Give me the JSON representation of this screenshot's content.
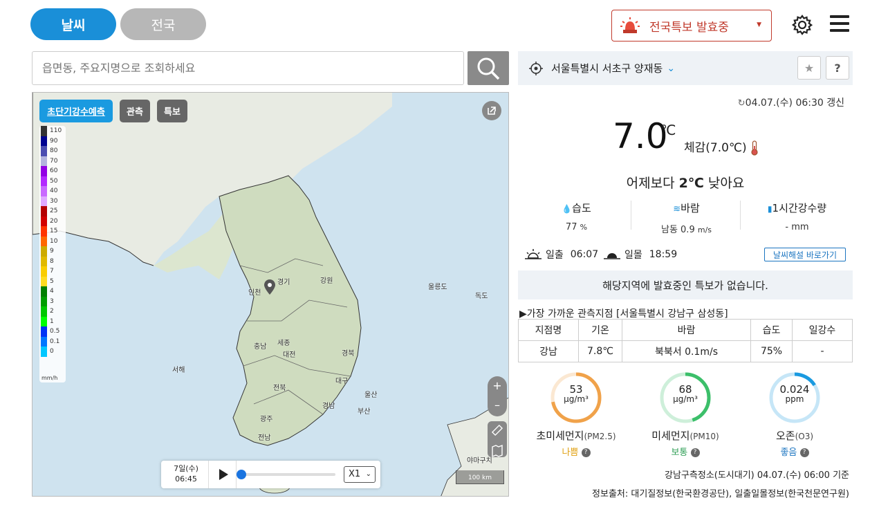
{
  "tabs": {
    "weather": "날씨",
    "national": "전국"
  },
  "alert": {
    "label": "전국특보 발효중",
    "color": "#c0392b"
  },
  "search": {
    "placeholder": "읍면동, 주요지명으로 조회하세요"
  },
  "map": {
    "buttons": {
      "precip": "초단기강수예측",
      "observe": "관측",
      "warning": "특보"
    },
    "legend": {
      "values": [
        "110",
        "90",
        "80",
        "70",
        "60",
        "50",
        "40",
        "30",
        "25",
        "20",
        "15",
        "10",
        "9",
        "8",
        "7",
        "5",
        "4",
        "3",
        "2",
        "1",
        "0.5",
        "0.1",
        "0"
      ],
      "colors": [
        "#333333",
        "#000390",
        "#4c4eb1",
        "#b3b4de",
        "#9300e4",
        "#b329ff",
        "#c969ff",
        "#e0a9ff",
        "#b40000",
        "#d20000",
        "#ff3300",
        "#ff6600",
        "#ccaa00",
        "#e0b900",
        "#f9cd00",
        "#ffdc1f",
        "#007f00",
        "#009d00",
        "#00c700",
        "#00ff00",
        "#0033f5",
        "#0077ff",
        "#00c7ff"
      ],
      "unit": "mm/h"
    },
    "labels": {
      "gyeonggi": "경기",
      "gangwon": "강원",
      "incheon": "인천",
      "ulleungdo": "울릉도",
      "dokdo": "독도",
      "chungnam": "충남",
      "sejong": "세종",
      "daejeon": "대전",
      "gyeongbuk": "경북",
      "seohae": "서해",
      "jeonbuk": "전북",
      "daegu": "대구",
      "ulsan": "울산",
      "gyeongnam": "경남",
      "busan": "부산",
      "gwangju": "광주",
      "jeonnam": "전남",
      "yamaguchi": "야마구치"
    },
    "zoom": {
      "plus": "+",
      "minus": "–"
    },
    "scale": "100 km",
    "timeline": {
      "date": "7일(수)",
      "time": "06:45",
      "speed": "X1",
      "progress": 0
    }
  },
  "location": {
    "name": "서울특별시 서초구 양재동",
    "star": "★",
    "help": "?"
  },
  "current": {
    "updated": "04.07.(수) 06:30 갱신",
    "temp": "7.0",
    "temp_unit": "℃",
    "feels_like": "체감(7.0℃)",
    "compare_prefix": "어제보다 ",
    "compare_value": "2℃",
    "compare_suffix": " 낮아요",
    "humidity": {
      "label": "습도",
      "value": "77",
      "unit": "%"
    },
    "wind": {
      "label": "바람",
      "value": "남동 0.9",
      "unit": "m/s"
    },
    "rain": {
      "label": "1시간강수량",
      "value": "- mm"
    },
    "sunrise": {
      "label": "일출",
      "time": "06:07"
    },
    "sunset": {
      "label": "일몰",
      "time": "18:59"
    },
    "explain_link": "날씨해설 바로가기"
  },
  "no_alert": "해당지역에 발효중인 특보가 없습니다.",
  "nearest_title": "▶가장 가까운 관측지점 [서울특별시 강남구 삼성동]",
  "obs_table": {
    "headers": [
      "지점명",
      "기온",
      "바람",
      "습도",
      "일강수"
    ],
    "row": [
      "강남",
      "7.8℃",
      "북북서 0.1m/s",
      "75%",
      "-"
    ]
  },
  "air": [
    {
      "value": "53",
      "unit": "μg/m³",
      "label": "초미세먼지",
      "sub": "(PM2.5)",
      "status": "나쁨",
      "color": "#f0a24a",
      "status_color": "#e0a010",
      "fraction": 0.72
    },
    {
      "value": "68",
      "unit": "μg/m³",
      "label": "미세먼지",
      "sub": "(PM10)",
      "status": "보통",
      "color": "#3cbf6a",
      "status_color": "#2e9e55",
      "fraction": 0.45
    },
    {
      "value": "0.024",
      "unit": "ppm",
      "label": "오존",
      "sub": "(O3)",
      "status": "좋음",
      "color": "#1a9ae0",
      "status_color": "#1a74c0",
      "fraction": 0.16
    }
  ],
  "station": "강남구측정소(도시대기) 04.07.(수) 06:00 기준",
  "source": "정보출처: 대기질정보(한국환경공단), 일출일몰정보(한국천문연구원)"
}
